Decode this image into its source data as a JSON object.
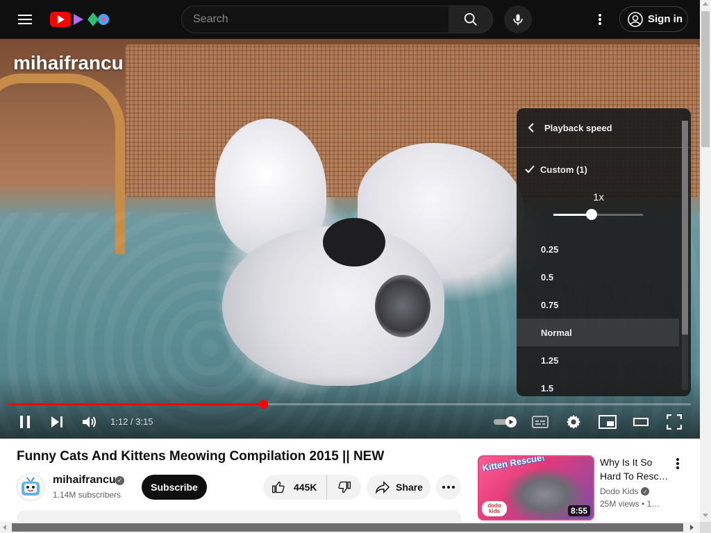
{
  "header": {
    "search_placeholder": "Search",
    "signin_label": "Sign in",
    "icons": [
      "menu-icon",
      "youtube-kids-logo",
      "search-icon",
      "mic-icon",
      "more-vert-icon",
      "account-circle-icon"
    ]
  },
  "player": {
    "watermark": "mihaifrancu",
    "current_time": "1:12",
    "duration": "3:15",
    "time_display": "1:12 / 3:15",
    "progress_fraction": 0.373,
    "autoplay": true,
    "playing": true,
    "colors": {
      "progress": "#ff0000"
    }
  },
  "speed_menu": {
    "title": "Playback speed",
    "custom_label": "Custom (1)",
    "slider_value_label": "1x",
    "slider_fraction": 0.43,
    "options": [
      "0.25",
      "0.5",
      "0.75",
      "Normal",
      "1.25",
      "1.5"
    ],
    "selected": "Normal"
  },
  "video": {
    "title": "Funny Cats And Kittens Meowing Compilation 2015 || NEW",
    "channel_name": "mihaifrancu",
    "subscribers": "1.14M subscribers",
    "subscribe_label": "Subscribe",
    "likes": "445K",
    "share_label": "Share"
  },
  "recommendation": {
    "title": "Why Is It So Hard To Resc…",
    "channel": "Dodo Kids",
    "views": "25M views",
    "meta_suffix": "• 1…",
    "duration": "8:55",
    "thumb_text": "Kitten Rescue!",
    "thumb_logo": "dodo kids"
  }
}
